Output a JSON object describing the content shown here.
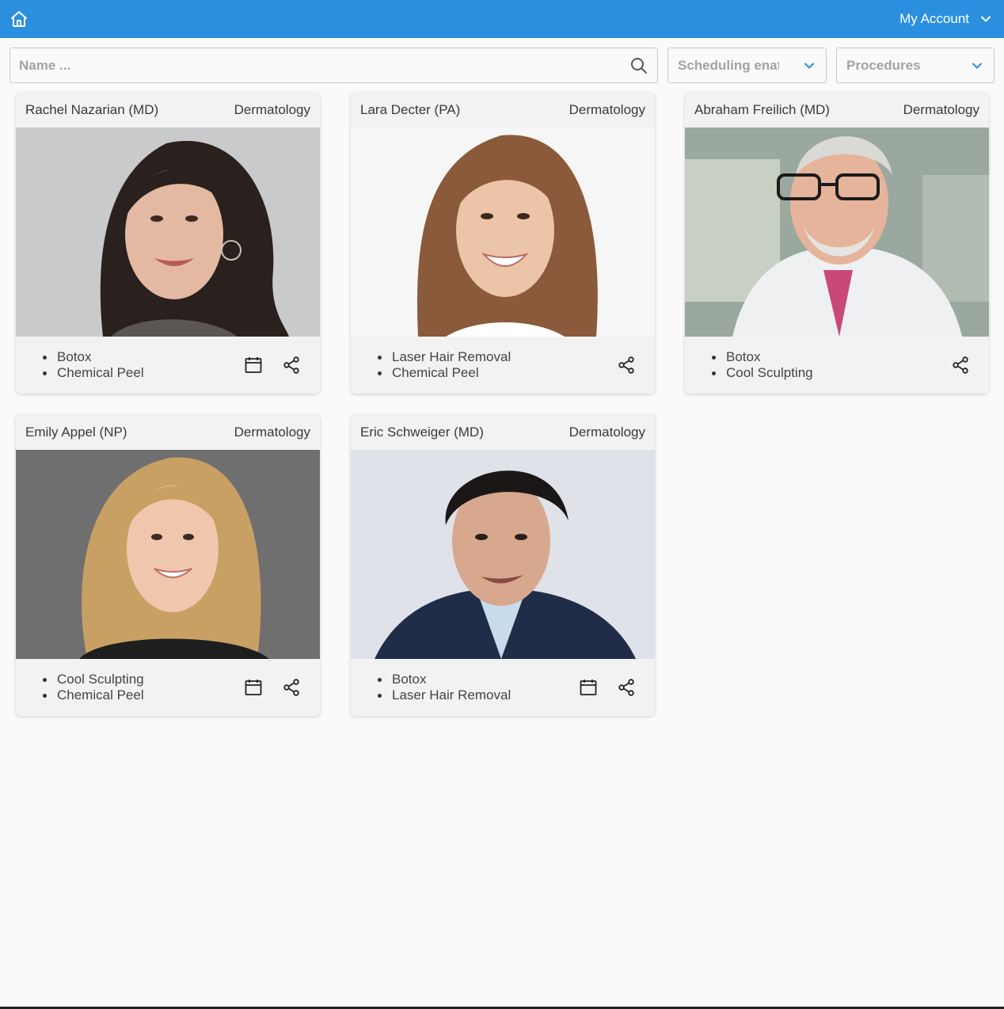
{
  "header": {
    "home_icon": "home-icon",
    "account_label": "My Account",
    "account_icon": "chevron-down-icon",
    "color": "#2b8fe0"
  },
  "filters": {
    "search_placeholder": "Name ...",
    "search_value": "",
    "search_icon": "search-icon",
    "scheduling_label": "Scheduling enat",
    "procedures_label": "Procedures"
  },
  "providers": [
    {
      "name": "Rachel Nazarian (MD)",
      "specialty": "Dermatology",
      "procedures": [
        "Botox",
        "Chemical Peel"
      ],
      "has_calendar": true
    },
    {
      "name": "Lara Decter (PA)",
      "specialty": "Dermatology",
      "procedures": [
        "Laser Hair Removal",
        "Chemical Peel"
      ],
      "has_calendar": false
    },
    {
      "name": "Abraham Freilich (MD)",
      "specialty": "Dermatology",
      "procedures": [
        "Botox",
        "Cool Sculpting"
      ],
      "has_calendar": false
    },
    {
      "name": "Emily Appel (NP)",
      "specialty": "Dermatology",
      "procedures": [
        "Cool Sculpting",
        "Chemical Peel"
      ],
      "has_calendar": true
    },
    {
      "name": "Eric Schweiger (MD)",
      "specialty": "Dermatology",
      "procedures": [
        "Botox",
        "Laser Hair Removal"
      ],
      "has_calendar": true
    }
  ]
}
